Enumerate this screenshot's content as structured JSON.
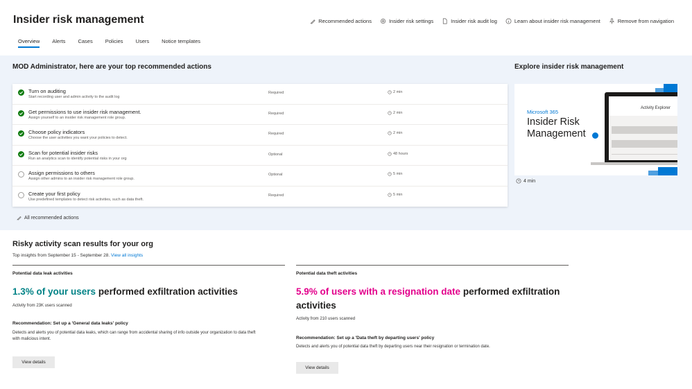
{
  "header": {
    "title": "Insider risk management",
    "commands": [
      {
        "label": "Recommended actions",
        "icon": "lightbulb-icon"
      },
      {
        "label": "Insider risk settings",
        "icon": "gear-icon"
      },
      {
        "label": "Insider risk audit log",
        "icon": "document-icon"
      },
      {
        "label": "Learn about insider risk management",
        "icon": "info-icon"
      },
      {
        "label": "Remove from navigation",
        "icon": "pin-icon"
      }
    ],
    "tabs": [
      "Overview",
      "Alerts",
      "Cases",
      "Policies",
      "Users",
      "Notice templates"
    ],
    "active_tab": "Overview"
  },
  "recommended": {
    "heading": "MOD Administrator, here are your top recommended actions",
    "actions": [
      {
        "title": "Turn on auditing",
        "desc": "Start recording user and admin activity to the audit log",
        "status": "Required",
        "time": "2 min",
        "done": true
      },
      {
        "title": "Get permissions to use insider risk management.",
        "desc": "Assign yourself to an insider risk management role group.",
        "status": "Required",
        "time": "2 min",
        "done": true
      },
      {
        "title": "Choose policy indicators",
        "desc": "Choose the user activities you want your policies to detect.",
        "status": "Required",
        "time": "2 min",
        "done": true
      },
      {
        "title": "Scan for potential insider risks",
        "desc": "Run an analytics scan to identify potential risks in your org",
        "status": "Optional",
        "time": "48 hours",
        "done": true
      },
      {
        "title": "Assign permissions to others",
        "desc": "Assign other admins to an insider risk management role group.",
        "status": "Optional",
        "time": "5 min",
        "done": false
      },
      {
        "title": "Create your first policy",
        "desc": "Use predefined templates to detect risk activities, such as data theft.",
        "status": "Required",
        "time": "5 min",
        "done": false
      }
    ],
    "all_link": "All recommended actions"
  },
  "explore": {
    "heading": "Explore insider risk management",
    "brand": "Microsoft 365",
    "title_line1": "Insider Risk",
    "title_line2": "Management",
    "screen_title": "Activity Explorer",
    "time": "4 min"
  },
  "scan": {
    "heading": "Risky activity scan results for your org",
    "subtitle_prefix": "Top insights from September 15 - September 28.",
    "view_all": "View all insights",
    "left": {
      "category": "Potential data leak activities",
      "highlight": "1.3% of your users",
      "rest": "performed exfiltration activities",
      "activity": "Activity from 23K users scanned",
      "rec": "Recommendation: Set up a 'General data leaks' policy",
      "desc": "Detects and alerts you of potential data leaks, which can range from accidental sharing of info outside your organization to data theft with malicious intent.",
      "button": "View details"
    },
    "right": {
      "category": "Potential data theft activities",
      "highlight": "5.9% of users with a resignation date",
      "rest": "performed exfiltration activities",
      "activity": "Activity from 210 users scanned",
      "rec": "Recommendation: Set up a 'Data theft by departing users' policy",
      "desc": "Detects and alerts you of potential data theft by departing users near their resignation or termination date.",
      "button": "View details"
    }
  },
  "colors": {
    "accent": "#0078d4",
    "success": "#107c10",
    "teal": "#038387",
    "pink": "#e3008c",
    "band": "#eef3fa"
  }
}
